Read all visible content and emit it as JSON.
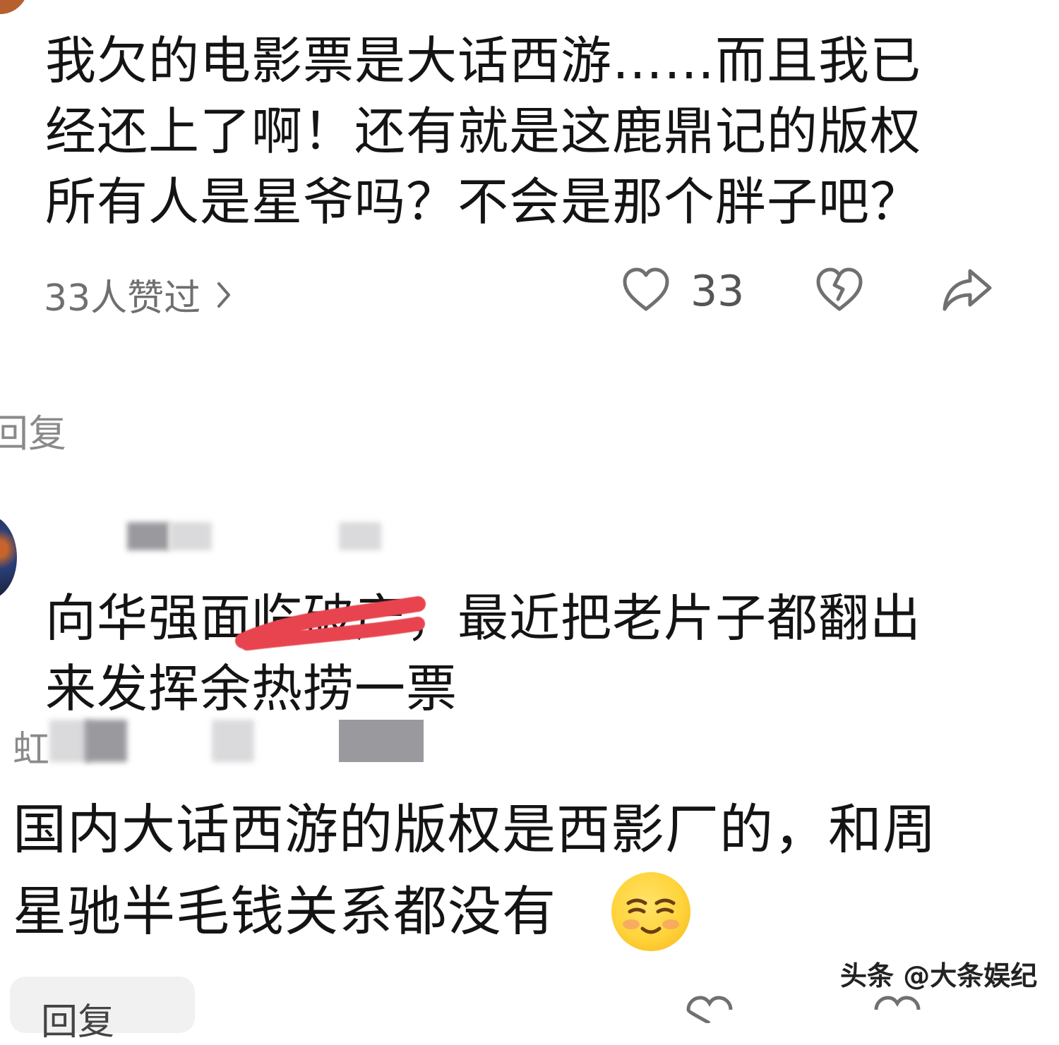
{
  "comment1": {
    "text": "我欠的电影票是大话西游……而且我已\n经还上了啊！还有就是这鹿鼎记的版权\n所有人是星爷吗？不会是那个胖子吧？",
    "likes_summary": "33人赞过",
    "like_count": "33"
  },
  "reply_label": "回复",
  "comment2": {
    "text": "向华强面临破产，最近把老片子都翻出\n来发挥余热捞一票"
  },
  "comment3": {
    "username_visible": "虹",
    "text": "国内大话西游的版权是西影厂的，和周\n星驰半毛钱关系都没有"
  },
  "bottom": {
    "reply_label": "回复"
  },
  "watermark": "头条 @大条娱纪",
  "icons": {
    "like": "heart-outline-icon",
    "dislike": "broken-heart-icon",
    "share": "share-arrow-icon",
    "chevron": "chevron-right-icon",
    "emoji": "relieved-face-emoji"
  },
  "colors": {
    "text": "#141414",
    "meta": "#6f6f6f",
    "redaction_stroke": "#e8444f"
  }
}
